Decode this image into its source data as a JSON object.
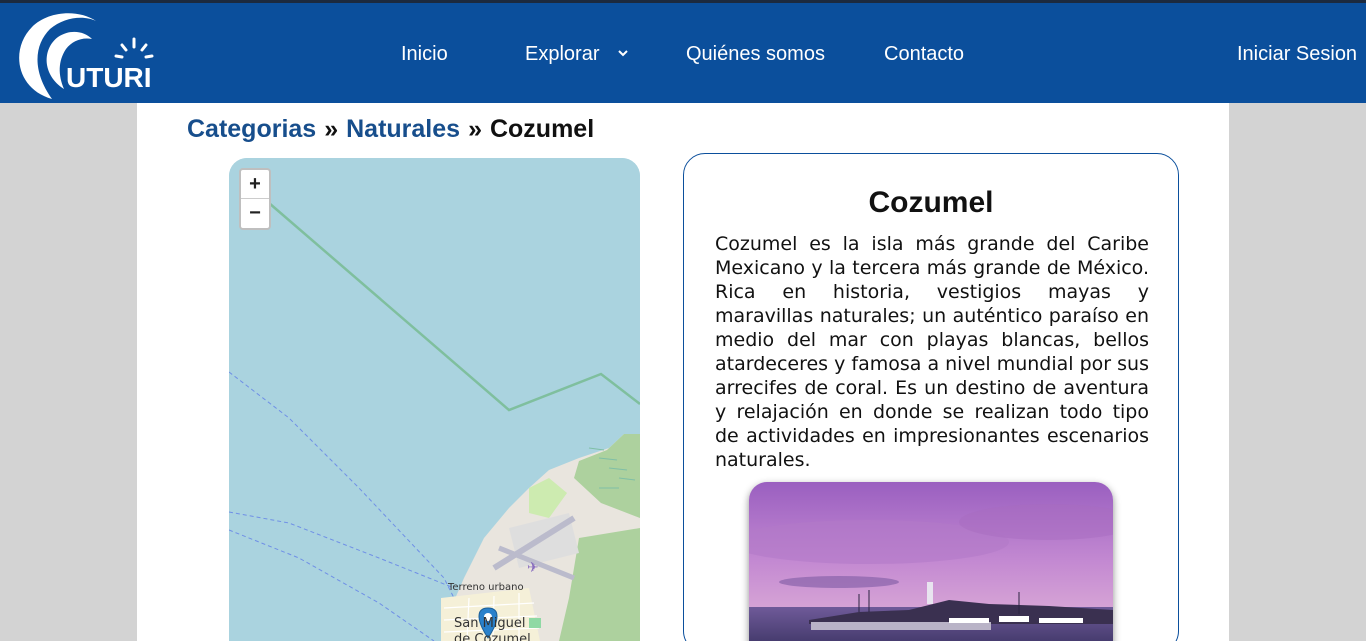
{
  "nav": {
    "logo_text": "UTURI",
    "links": [
      "Inicio",
      "Explorar",
      "Quiénes somos",
      "Contacto"
    ],
    "login": "Iniciar Sesion"
  },
  "breadcrumb": {
    "items": [
      "Categorias",
      "Naturales"
    ],
    "separator": "»",
    "current": "Cozumel"
  },
  "map": {
    "zoom_in": "+",
    "zoom_out": "−",
    "labels": [
      "Terreno urbano",
      "San Miguel",
      "de Cozumel"
    ]
  },
  "card": {
    "title": "Cozumel",
    "description": "Cozumel es la isla más grande del Caribe Mexicano y la tercera más grande de México. Rica en historia, vestigios mayas y maravillas naturales; un auténtico paraíso en medio del mar con playas blancas, bellos atardeceres y famosa a nivel mundial por sus arrecifes de coral. Es un destino de aventura y relajación en donde se realizan todo tipo de actividades en impresionantes escenarios naturales."
  },
  "colors": {
    "nav_bg": "#0b4f9c",
    "link_blue": "#174e8c",
    "sea": "#aad3df",
    "land": "#f2efe9",
    "forest": "#add19e"
  }
}
